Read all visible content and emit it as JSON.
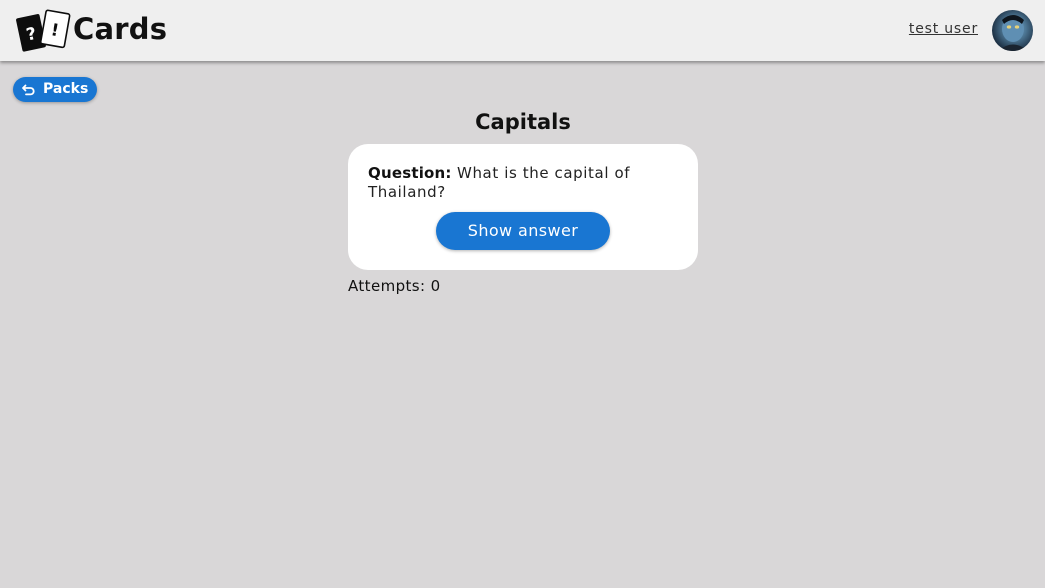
{
  "header": {
    "brand": "Cards",
    "user_name": "test user"
  },
  "nav": {
    "back_label": "Packs"
  },
  "pack": {
    "title": "Capitals"
  },
  "card": {
    "question_label": "Question:",
    "question_text": "What is the capital of Thailand?",
    "show_answer_label": "Show answer"
  },
  "stats": {
    "attempts_label": "Attempts:",
    "attempts_value": "0"
  },
  "colors": {
    "accent": "#1976d2",
    "background": "#d9d7d8",
    "header_background": "#efefef",
    "card_background": "#ffffff"
  },
  "icons": {
    "logo": "question-exclamation-cards-logo",
    "back": "undo-arrow-icon",
    "avatar": "user-avatar"
  }
}
